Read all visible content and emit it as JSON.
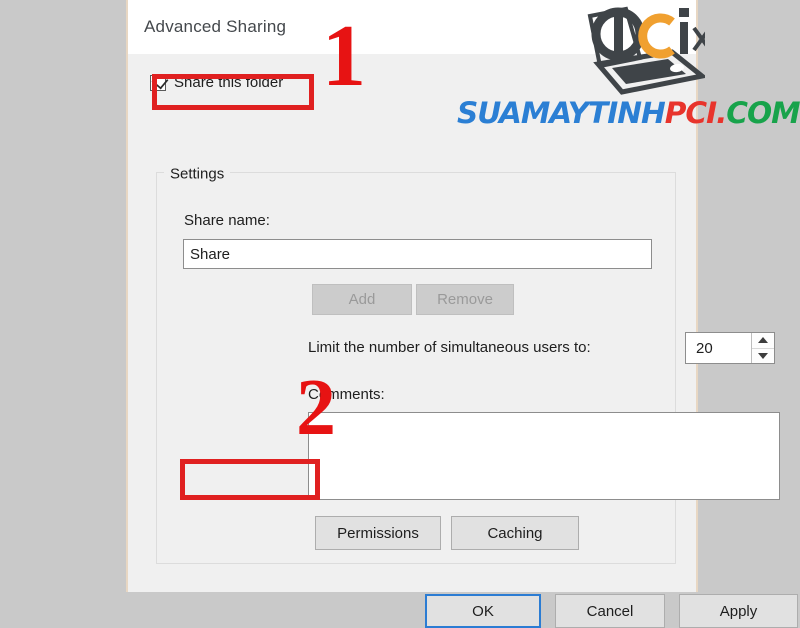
{
  "dialog": {
    "title": "Advanced Sharing",
    "share_folder_label": "Share this folder",
    "share_folder_checked": true,
    "settings_legend": "Settings",
    "share_name_label": "Share name:",
    "share_name_value": "Share",
    "share_name_placeholder": "",
    "add_label": "Add",
    "add_disabled": true,
    "remove_label": "Remove",
    "remove_disabled": true,
    "limit_users_label": "Limit the number of simultaneous users to:",
    "limit_users_value": "20",
    "comments_label": "Comments:",
    "comments_value": "",
    "comments_placeholder": "",
    "permissions_label": "Permissions",
    "caching_label": "Caching",
    "ok_label": "OK",
    "cancel_label": "Cancel",
    "apply_label": "Apply"
  },
  "annotations": {
    "step_one": "1",
    "step_two": "2",
    "highlight_color": "#e02020",
    "number_color": "#e71313"
  },
  "watermark": {
    "logo_text_p": "p",
    "logo_text_c": "c",
    "logo_text_i": "i",
    "logo_text_x": "x",
    "site_part_1": "SUAMAYTINH",
    "site_part_2": "PCI.",
    "site_part_3": "COM",
    "color_blue": "#2b7fd4",
    "color_red": "#e8342c",
    "color_green": "#18a34b",
    "color_orange": "#f0a030",
    "color_dark": "#3f4448"
  }
}
